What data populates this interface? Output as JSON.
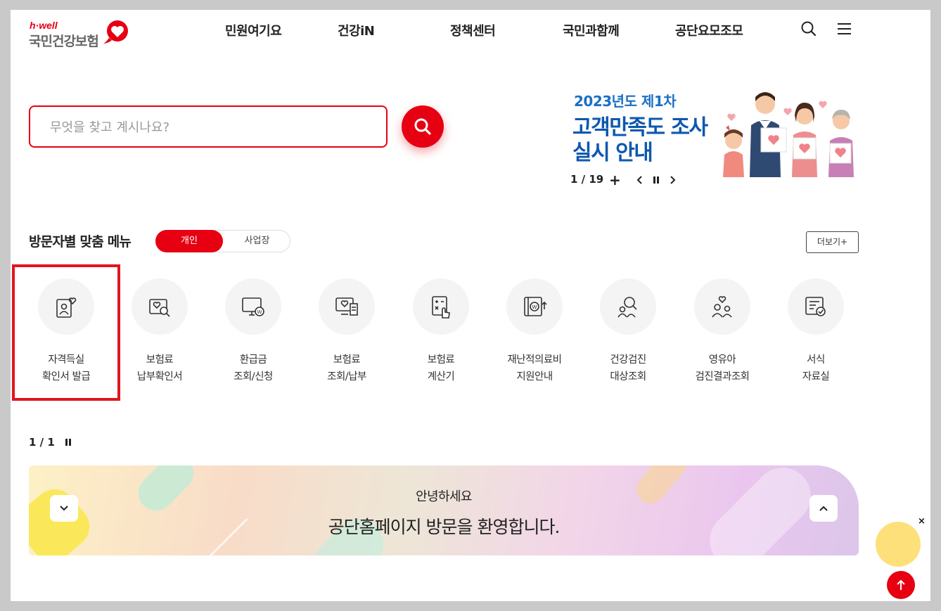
{
  "logo": {
    "brand": "h·well",
    "name": "국민건강보험"
  },
  "nav": [
    {
      "label": "민원여기요"
    },
    {
      "label": "건강iN"
    },
    {
      "label": "정책센터"
    },
    {
      "label": "국민과함께"
    },
    {
      "label": "공단요모조모"
    }
  ],
  "search": {
    "placeholder": "무엇을 찾고 계시나요?"
  },
  "banner": {
    "year_line": "2023년도 제1차",
    "title_line1": "고객만족도 조사",
    "title_line2": "실시 안내",
    "page": "1 / 19",
    "plus": "+"
  },
  "menu": {
    "title": "방문자별 맞춤 메뉴",
    "toggle_personal": "개인",
    "toggle_business": "사업장",
    "more": "더보기+",
    "tiles": [
      {
        "line1": "자격득실",
        "line2": "확인서 발급",
        "icon": "id-card-heart-icon"
      },
      {
        "line1": "보험료",
        "line2": "납부확인서",
        "icon": "document-search-icon"
      },
      {
        "line1": "환급금",
        "line2": "조회/신청",
        "icon": "monitor-won-icon"
      },
      {
        "line1": "보험료",
        "line2": "조회/납부",
        "icon": "screen-receipt-icon"
      },
      {
        "line1": "보험료",
        "line2": "계산기",
        "icon": "calculator-hand-icon"
      },
      {
        "line1": "재난적의료비",
        "line2": "지원안내",
        "icon": "book-won-icon"
      },
      {
        "line1": "건강검진",
        "line2": "대상조회",
        "icon": "people-search-icon"
      },
      {
        "line1": "영유아",
        "line2": "검진결과조회",
        "icon": "family-heart-icon"
      },
      {
        "line1": "서식",
        "line2": "자료실",
        "icon": "form-check-icon"
      }
    ],
    "page": "1 / 1"
  },
  "welcome": {
    "greeting": "안녕하세요",
    "message": "공단홈페이지 방문을 환영합니다."
  },
  "floating": {
    "close": "×"
  },
  "colors": {
    "brand_red": "#e60012",
    "banner_blue": "#0d58ae"
  }
}
